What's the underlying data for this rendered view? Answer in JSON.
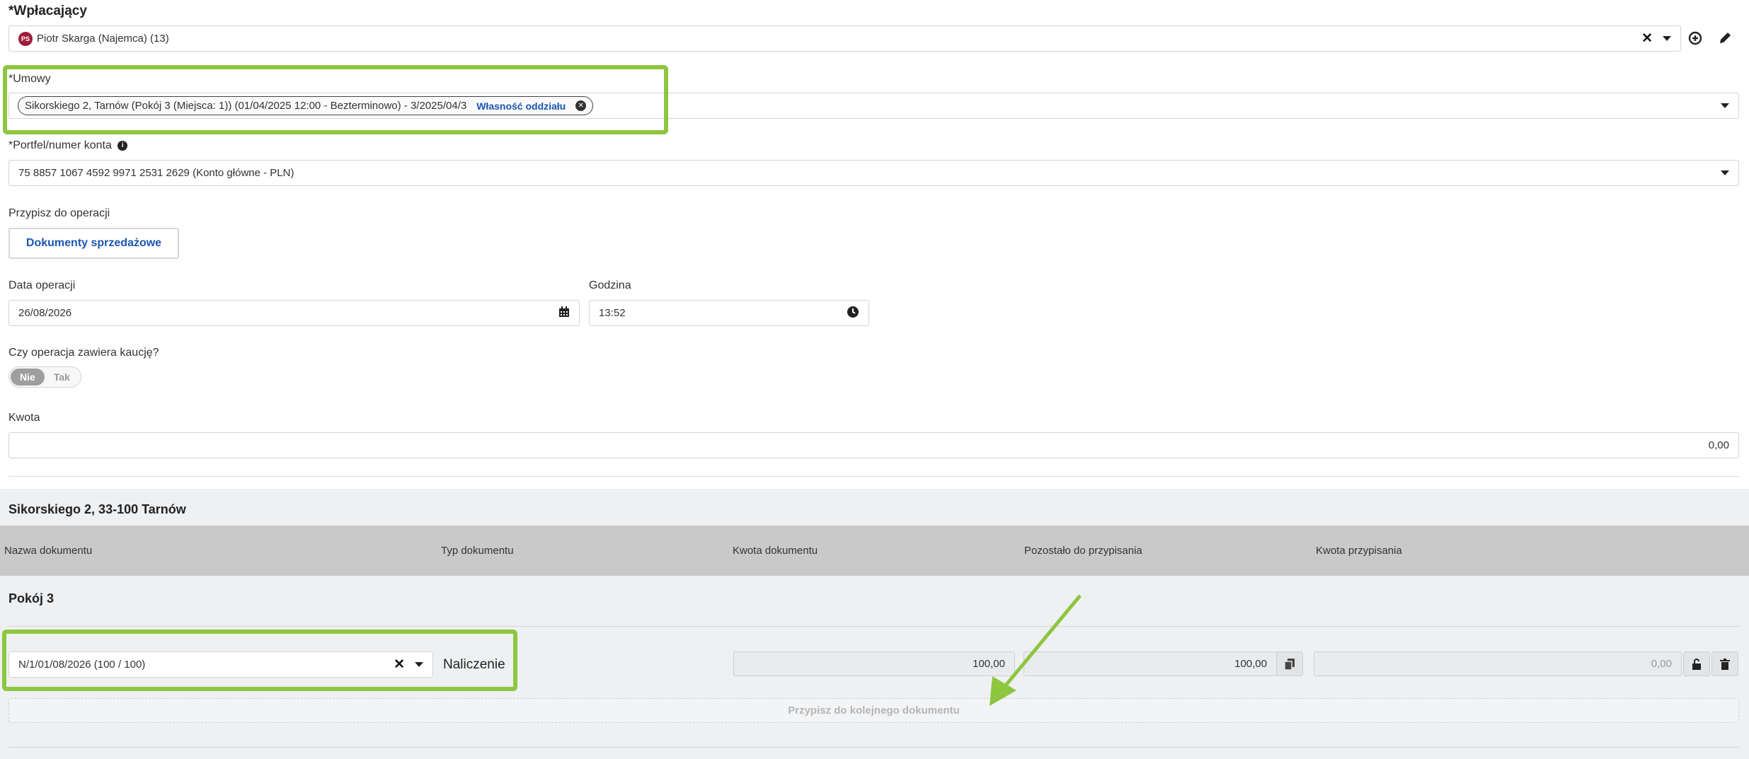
{
  "payer": {
    "label": "*Wpłacający",
    "avatar_initials": "PS",
    "value": "Piotr Skarga (Najemca) (13)",
    "clear_icon": "close-icon",
    "add_icon": "plus-circle-icon",
    "edit_icon": "pencil-icon"
  },
  "contracts": {
    "label": "*Umowy",
    "tag_text": "Sikorskiego 2, Tarnów (Pokój 3 (Miejsca: 1)) (01/04/2025 12:00 - Bezterminowo) - 3/2025/04/3",
    "tag_badge": "Własność oddziału"
  },
  "wallet": {
    "label": "*Portfel/numer konta",
    "value": "75 8857 1067 4592 9971 2531 2629 (Konto główne - PLN)"
  },
  "assign": {
    "label": "Przypisz do operacji",
    "button": "Dokumenty sprzedażowe"
  },
  "date": {
    "label": "Data operacji",
    "value": "26/08/2026"
  },
  "time": {
    "label": "Godzina",
    "value": "13:52"
  },
  "deposit": {
    "label": "Czy operacja zawiera kaucję?",
    "options": [
      "Nie",
      "Tak"
    ],
    "selected": "Nie"
  },
  "amount": {
    "label": "Kwota",
    "value": "0,00"
  },
  "table": {
    "section_title": "Sikorskiego 2, 33-100 Tarnów",
    "headers": [
      "Nazwa dokumentu",
      "Typ dokumentu",
      "Kwota dokumentu",
      "Pozostało do przypisania",
      "Kwota przypisania"
    ],
    "group_title": "Pokój 3",
    "row": {
      "document": "N/1/01/08/2026 (100 / 100)",
      "type": "Naliczenie",
      "doc_amount": "100,00",
      "remaining": "100,00",
      "assigned": "0,00"
    },
    "next_button": "Przypisz do kolejnego dokumentu"
  },
  "colors": {
    "highlight": "#8dc63f",
    "link": "#1a56b0",
    "avatar": "#a01c3c"
  }
}
